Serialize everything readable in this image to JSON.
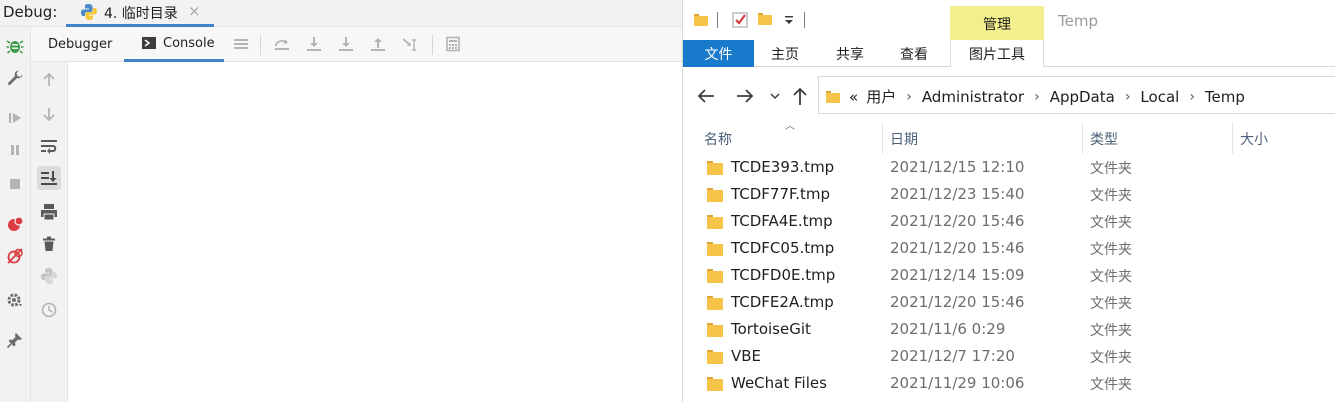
{
  "ide": {
    "debug_label": "Debug:",
    "run_tab": "4. 临时目录",
    "tab_close": "×",
    "tabs": {
      "debugger": "Debugger",
      "console": "Console"
    }
  },
  "explorer": {
    "window_title": "Temp",
    "context_group": "管理",
    "ribbon_tabs": [
      "文件",
      "主页",
      "共享",
      "查看",
      "图片工具"
    ],
    "breadcrumb": [
      "«",
      "用户",
      "Administrator",
      "AppData",
      "Local",
      "Temp"
    ],
    "columns": [
      "名称",
      "日期",
      "类型",
      "大小"
    ],
    "rows": [
      {
        "name": "TCDE393.tmp",
        "date": "2021/12/15 12:10",
        "type": "文件夹"
      },
      {
        "name": "TCDF77F.tmp",
        "date": "2021/12/23 15:40",
        "type": "文件夹"
      },
      {
        "name": "TCDFA4E.tmp",
        "date": "2021/12/20 15:46",
        "type": "文件夹"
      },
      {
        "name": "TCDFC05.tmp",
        "date": "2021/12/20 15:46",
        "type": "文件夹"
      },
      {
        "name": "TCDFD0E.tmp",
        "date": "2021/12/14 15:09",
        "type": "文件夹"
      },
      {
        "name": "TCDFE2A.tmp",
        "date": "2021/12/20 15:46",
        "type": "文件夹"
      },
      {
        "name": "TortoiseGit",
        "date": "2021/11/6 0:29",
        "type": "文件夹"
      },
      {
        "name": "VBE",
        "date": "2021/12/7 17:20",
        "type": "文件夹"
      },
      {
        "name": "WeChat Files",
        "date": "2021/11/29 10:06",
        "type": "文件夹"
      }
    ]
  },
  "colors": {
    "ide_accent": "#4083c9",
    "debug_green": "#3f9b4a",
    "file_tab_blue": "#1979ca",
    "context_tab_yellow": "#f3ef8e",
    "folder_yellow": "#f5c448"
  }
}
